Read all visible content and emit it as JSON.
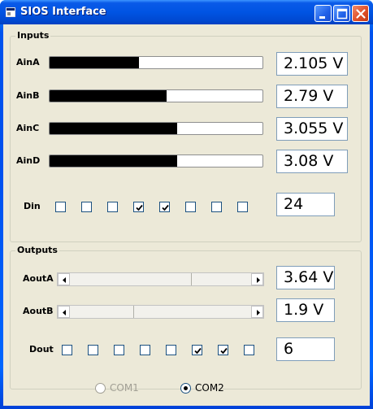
{
  "window": {
    "title": "SIOS Interface"
  },
  "inputs": {
    "group_title": "Inputs",
    "analog": [
      {
        "label": "AinA",
        "value": "2.105 V",
        "level": 0.42
      },
      {
        "label": "AinB",
        "value": "2.79 V",
        "level": 0.55
      },
      {
        "label": "AinC",
        "value": "3.055 V",
        "level": 0.6
      },
      {
        "label": "AinD",
        "value": "3.08 V",
        "level": 0.6
      }
    ],
    "digital": {
      "label": "Din",
      "value": "24",
      "bits": [
        false,
        false,
        false,
        true,
        true,
        false,
        false,
        false
      ]
    }
  },
  "outputs": {
    "group_title": "Outputs",
    "analog": [
      {
        "label": "AoutA",
        "value": "3.64 V",
        "level": 0.67
      },
      {
        "label": "AoutB",
        "value": "1.9 V",
        "level": 0.35
      }
    ],
    "digital": {
      "label": "Dout",
      "value": "6",
      "bits": [
        false,
        false,
        false,
        false,
        false,
        true,
        true,
        false
      ]
    }
  },
  "ports": {
    "options": [
      {
        "label": "COM1",
        "selected": false,
        "enabled": false
      },
      {
        "label": "COM2",
        "selected": true,
        "enabled": true
      }
    ]
  },
  "icons": {
    "app": "window-app-icon",
    "minimize": "minimize-icon",
    "maximize": "maximize-icon",
    "close": "close-icon",
    "check": "check-icon",
    "arrow_left": "arrow-left-icon",
    "arrow_right": "arrow-right-icon"
  },
  "colors": {
    "titlebar": "#0054e3",
    "client": "#ece9d8",
    "progress_fill": "#000000",
    "close_button": "#e0502a"
  }
}
